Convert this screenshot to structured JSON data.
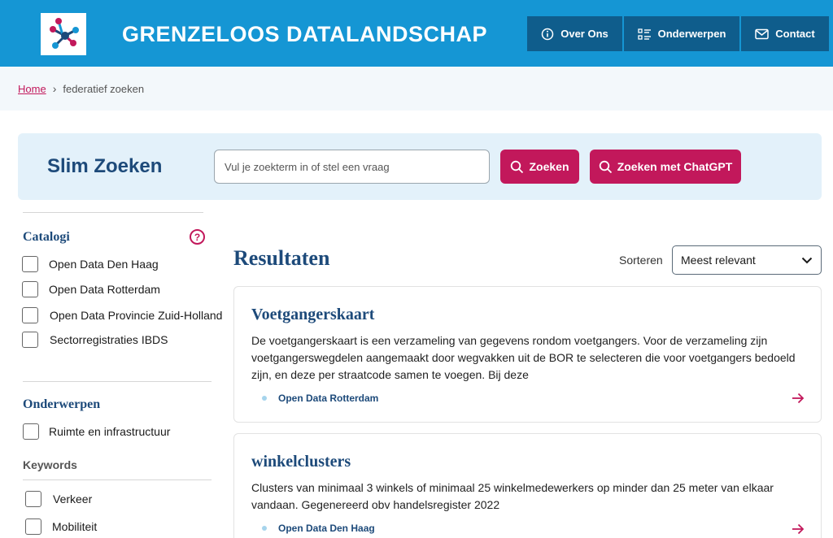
{
  "header": {
    "title": "GRENZELOOS DATALANDSCHAP",
    "logo_icon": "network-logo",
    "nav": [
      {
        "label": "Over Ons",
        "icon": "info-icon"
      },
      {
        "label": "Onderwerpen",
        "icon": "list-icon"
      },
      {
        "label": "Contact",
        "icon": "mail-icon"
      }
    ]
  },
  "breadcrumb": {
    "home": "Home",
    "current": "federatief zoeken"
  },
  "search": {
    "title": "Slim Zoeken",
    "placeholder": "Vul je zoekterm in of stel een vraag",
    "button": "Zoeken",
    "chatgpt_button": "Zoeken met ChatGPT"
  },
  "sidebar": {
    "catalogi_title": "Catalogi",
    "help": "?",
    "catalogi": [
      "Open Data Den Haag",
      "Open Data Rotterdam",
      "Open Data Provincie Zuid-Holland",
      "Sectorregistraties IBDS"
    ],
    "onderwerpen_title": "Onderwerpen",
    "onderwerpen": [
      "Ruimte en infrastructuur"
    ],
    "keywords_title": "Keywords",
    "keywords": [
      "Verkeer",
      "Mobiliteit"
    ]
  },
  "results": {
    "title": "Resultaten",
    "sort_label": "Sorteren",
    "sort_value": "Meest relevant",
    "items": [
      {
        "title": "Voetgangerskaart",
        "description": "De voetgangerskaart is een verzameling van gegevens rondom voetgangers. Voor de verzameling zijn voetgangerswegdelen aangemaakt door wegvakken uit de BOR te selecteren die voor voetgangers bedoeld zijn, en deze per straatcode samen te voegen. Bij deze",
        "source": "Open Data Rotterdam"
      },
      {
        "title": "winkelclusters",
        "description": "Clusters van minimaal 3 winkels of minimaal 25 winkelmedewerkers op minder dan 25 meter van elkaar vandaan. Gegenereerd obv handelsregister 2022",
        "source": "Open Data Den Haag"
      }
    ]
  },
  "colors": {
    "header": "#1596d4",
    "nav": "#0f5d8c",
    "accent": "#c2185b",
    "title": "#1d4a7a",
    "search_panel": "#e3f1fa"
  }
}
